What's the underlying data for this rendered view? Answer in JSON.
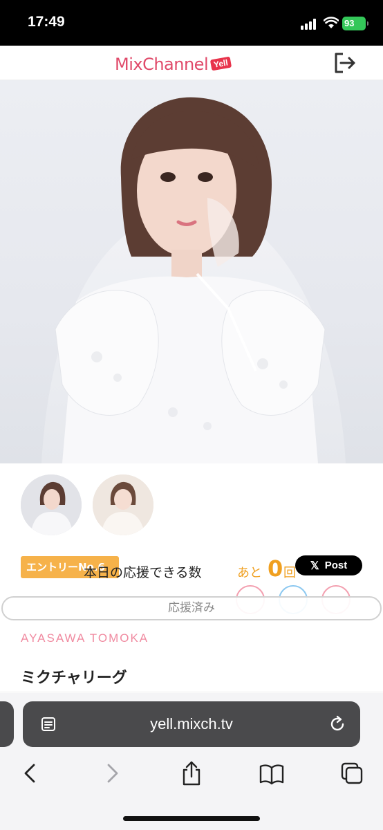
{
  "status_bar": {
    "time": "17:49",
    "battery": "93"
  },
  "header": {
    "logo_text": "MixChannel",
    "logo_badge": "Yell",
    "logout_icon": "logout-icon"
  },
  "profile": {
    "entry_badge": "エントリーNo.6",
    "daily_cheer_label": "本日の応援できる数",
    "remaining_prefix": "あと",
    "remaining_count": "0",
    "remaining_suffix": "回",
    "x_post_label": "Post",
    "cheer_done_label": "応援済み",
    "romaji_name": "AYASAWA TOMOKA",
    "league_title": "ミクチャリーグ"
  },
  "browser": {
    "url": "yell.mixch.tv",
    "toolbar_icons": [
      "back-icon",
      "forward-icon",
      "share-icon",
      "bookmarks-icon",
      "tabs-icon"
    ]
  },
  "colors": {
    "accent_pink": "#e04a6a",
    "badge_orange": "#f6b24a",
    "count_orange": "#f0a020",
    "romaji_pink": "#f08aa0",
    "battery_green": "#34c759"
  }
}
